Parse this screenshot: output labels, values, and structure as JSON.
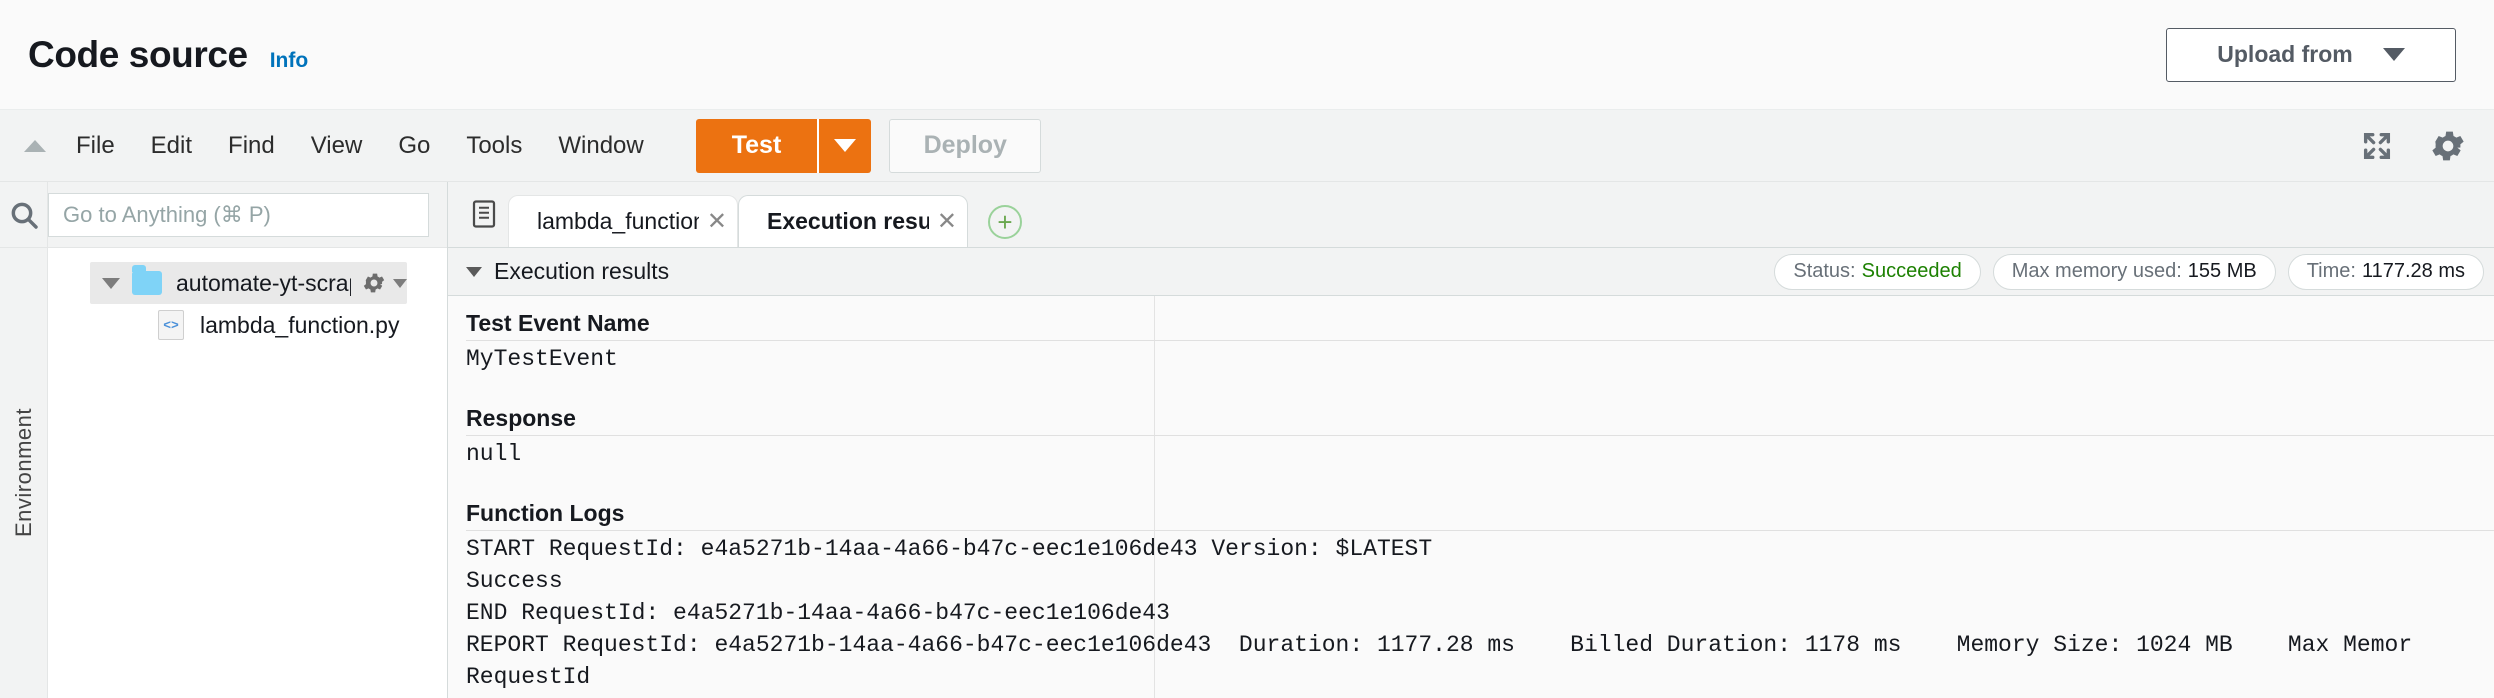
{
  "header": {
    "title": "Code source",
    "info_label": "Info",
    "upload_button": "Upload from",
    "upload_caret_icon": "chevron-down-icon"
  },
  "menubar": {
    "collapse_icon": "triangle-up-icon",
    "items": [
      {
        "label": "File"
      },
      {
        "label": "Edit"
      },
      {
        "label": "Find"
      },
      {
        "label": "View"
      },
      {
        "label": "Go"
      },
      {
        "label": "Tools"
      },
      {
        "label": "Window"
      }
    ],
    "test_button": "Test",
    "test_dropdown_icon": "chevron-down-icon",
    "deploy_button": "Deploy",
    "fullscreen_icon": "expand-arrows-icon",
    "settings_icon": "gear-icon",
    "accent_color": "#ec7211"
  },
  "sidebar": {
    "rail_label": "Environment",
    "search_icon": "search-icon",
    "search": {
      "placeholder": "Go to Anything (⌘ P)",
      "value": ""
    },
    "tree": [
      {
        "label": "automate-yt-scrap-f",
        "type": "folder",
        "expand_icon": "triangle-down-icon",
        "folder_icon": "folder-icon",
        "gear_icon": "gear-icon",
        "gear_caret_icon": "chevron-down-icon"
      },
      {
        "label": "lambda_function.py",
        "type": "file",
        "file_icon": "code-file-icon"
      }
    ]
  },
  "editor": {
    "tabstrip_icon": "panel-toggle-icon",
    "tabs": [
      {
        "label": "lambda_function.",
        "active": false,
        "close_icon": "close-icon"
      },
      {
        "label": "Execution results",
        "active": true,
        "close_icon": "close-icon"
      }
    ],
    "add_tab_icon": "plus-circle-icon"
  },
  "results": {
    "collapse_icon": "triangle-down-icon",
    "title": "Execution results",
    "badges": [
      {
        "label": "Status:",
        "value": "Succeeded",
        "status": "ok"
      },
      {
        "label": "Max memory used:",
        "value": "155 MB",
        "status": "neutral"
      },
      {
        "label": "Time:",
        "value": "1177.28 ms",
        "status": "neutral"
      }
    ],
    "sections": [
      {
        "heading": "Test Event Name",
        "lines": [
          "MyTestEvent"
        ]
      },
      {
        "heading": "Response",
        "lines": [
          "null"
        ]
      },
      {
        "heading": "Function Logs",
        "lines": [
          "START RequestId: e4a5271b-14aa-4a66-b47c-eec1e106de43 Version: $LATEST",
          "Success",
          "END RequestId: e4a5271b-14aa-4a66-b47c-eec1e106de43",
          "REPORT RequestId: e4a5271b-14aa-4a66-b47c-eec1e106de43  Duration: 1177.28 ms    Billed Duration: 1178 ms    Memory Size: 1024 MB    Max Memor",
          "RequestId"
        ]
      }
    ]
  }
}
